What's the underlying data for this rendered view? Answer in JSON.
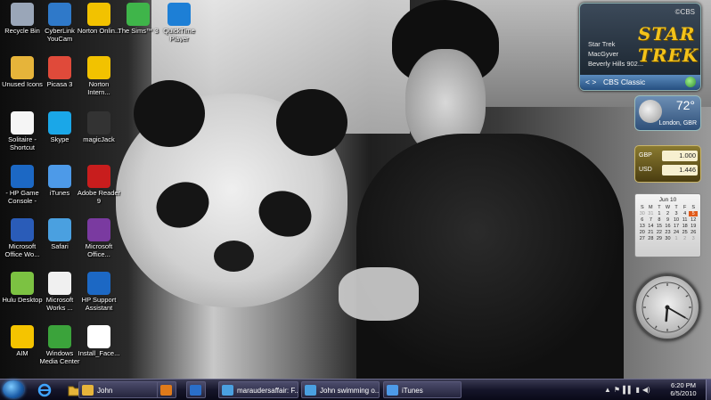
{
  "desktop_icons": [
    {
      "label": "Recycle Bin",
      "icon": "recycle-bin-icon",
      "color": "#9aa6b8"
    },
    {
      "label": "CyberLink YouCam",
      "icon": "youcam-icon",
      "color": "#2f79c9"
    },
    {
      "label": "Norton Onlin...",
      "icon": "norton-online-icon",
      "color": "#f2c200"
    },
    {
      "label": "The Sims™ 3",
      "icon": "sims-icon",
      "color": "#3fb54a"
    },
    {
      "label": "QuickTime Player",
      "icon": "quicktime-icon",
      "color": "#1d7fd6"
    },
    {
      "label": "Unused Icons",
      "icon": "folder-icon",
      "color": "#e6b43a"
    },
    {
      "label": "Picasa 3",
      "icon": "picasa-icon",
      "color": "#e04a3a"
    },
    {
      "label": "Norton Intern...",
      "icon": "norton-internet-icon",
      "color": "#f2c200"
    },
    {
      "label": "Solitaire - Shortcut",
      "icon": "solitaire-icon",
      "color": "#f5f5f5"
    },
    {
      "label": "Skype",
      "icon": "skype-icon",
      "color": "#1aa7e8"
    },
    {
      "label": "magicJack",
      "icon": "magicjack-icon",
      "color": "#333333"
    },
    {
      "label": "- HP Game Console -",
      "icon": "hp-game-console-icon",
      "color": "#1c68c4"
    },
    {
      "label": "iTunes",
      "icon": "itunes-icon",
      "color": "#4d9ae8"
    },
    {
      "label": "Adobe Reader 9",
      "icon": "adobe-reader-icon",
      "color": "#c81d1d"
    },
    {
      "label": "Microsoft Office Wo...",
      "icon": "word-icon",
      "color": "#2a5cb8"
    },
    {
      "label": "Safari",
      "icon": "safari-icon",
      "color": "#4aa0e0"
    },
    {
      "label": "Microsoft Office...",
      "icon": "onenote-icon",
      "color": "#7a3aa0"
    },
    {
      "label": "Hulu Desktop",
      "icon": "hulu-icon",
      "color": "#7cc242"
    },
    {
      "label": "Microsoft Works ...",
      "icon": "works-calendar-icon",
      "color": "#f0f0f0"
    },
    {
      "label": "HP Support Assistant",
      "icon": "hp-support-icon",
      "color": "#1c68c4"
    },
    {
      "label": "AIM",
      "icon": "aim-icon",
      "color": "#f5c400"
    },
    {
      "label": "Windows Media Center",
      "icon": "media-center-icon",
      "color": "#3ba33b"
    },
    {
      "label": "Install_Face...",
      "icon": "document-icon",
      "color": "#ffffff"
    }
  ],
  "gadgets": {
    "cbs": {
      "network": "©CBS",
      "show_logo": "STAR TREK",
      "shows": [
        "Star Trek",
        "MacGyver",
        "Beverly Hills 902..."
      ],
      "nav": "< >",
      "channel": "CBS Classic"
    },
    "weather": {
      "temperature": "72°",
      "location": "London, GBR"
    },
    "currency": [
      {
        "code": "GBP",
        "value": "1.000"
      },
      {
        "code": "USD",
        "value": "1.446"
      }
    ],
    "calendar": {
      "month": "Jun 10",
      "weekdays": [
        "S",
        "M",
        "T",
        "W",
        "T",
        "F",
        "S"
      ],
      "days": [
        "30",
        "31",
        "1",
        "2",
        "3",
        "4",
        "5",
        "6",
        "7",
        "8",
        "9",
        "10",
        "11",
        "12",
        "13",
        "14",
        "15",
        "16",
        "17",
        "18",
        "19",
        "20",
        "21",
        "22",
        "23",
        "24",
        "25",
        "26",
        "27",
        "28",
        "29",
        "30",
        "1",
        "2",
        "3"
      ],
      "today": "5"
    },
    "clock": {
      "hour_angle": 185,
      "minute_angle": 120
    }
  },
  "taskbar": {
    "quick_launch": [
      {
        "icon": "internet-explorer-icon"
      },
      {
        "icon": "folder-icon"
      }
    ],
    "buttons": [
      {
        "label": "John",
        "icon": "folder-icon",
        "color": "#e6b43a"
      },
      {
        "label": "",
        "icon": "media-player-icon",
        "color": "#e07a1a"
      },
      {
        "label": "",
        "icon": "dvd-icon",
        "color": "#2a6fc9"
      },
      {
        "label": "maraudersaffair: F...",
        "icon": "browser-icon",
        "color": "#4aa0e0"
      },
      {
        "label": "John swimming o...",
        "icon": "browser-icon",
        "color": "#4aa0e0"
      },
      {
        "label": "iTunes",
        "icon": "itunes-icon",
        "color": "#4d9ae8"
      }
    ],
    "tray_time": "6:20 PM",
    "tray_date": "6/5/2010"
  }
}
